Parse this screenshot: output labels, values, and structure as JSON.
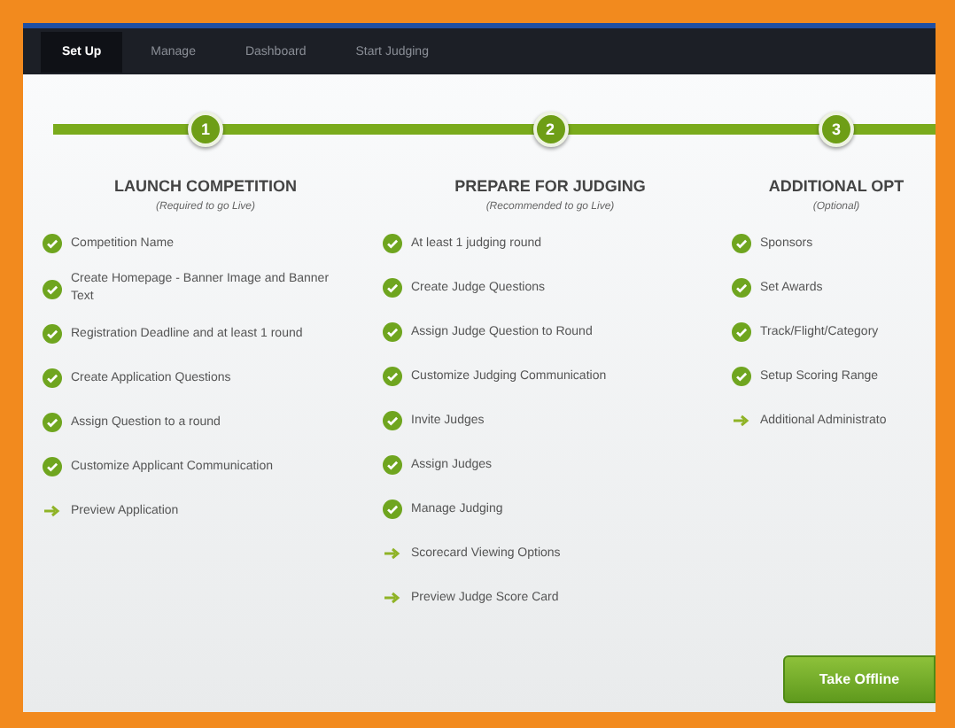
{
  "nav": {
    "tabs": [
      {
        "label": "Set Up",
        "selected": true
      },
      {
        "label": "Manage",
        "selected": false
      },
      {
        "label": "Dashboard",
        "selected": false
      },
      {
        "label": "Start Judging",
        "selected": false
      }
    ]
  },
  "steps": [
    {
      "number": "1",
      "completed": true,
      "title": "LAUNCH COMPETITION",
      "subtitle": "(Required to go Live)",
      "items": [
        {
          "kind": "done",
          "label": "Competition Name"
        },
        {
          "kind": "done",
          "label": "Create Homepage - Banner Image and Banner Text"
        },
        {
          "kind": "done",
          "label": "Registration Deadline and at least 1 round"
        },
        {
          "kind": "done",
          "label": "Create Application Questions"
        },
        {
          "kind": "done",
          "label": "Assign Question to a round"
        },
        {
          "kind": "done",
          "label": "Customize Applicant Communication"
        },
        {
          "kind": "todo",
          "label": "Preview Application"
        }
      ]
    },
    {
      "number": "2",
      "completed": true,
      "title": "PREPARE FOR JUDGING",
      "subtitle": "(Recommended to go Live)",
      "items": [
        {
          "kind": "done",
          "label": "At least 1 judging round"
        },
        {
          "kind": "done",
          "label": "Create Judge Questions"
        },
        {
          "kind": "done",
          "label": "Assign Judge Question to Round"
        },
        {
          "kind": "done",
          "label": "Customize Judging Communication"
        },
        {
          "kind": "done",
          "label": "Invite Judges"
        },
        {
          "kind": "done",
          "label": "Assign Judges"
        },
        {
          "kind": "done",
          "label": "Manage Judging"
        },
        {
          "kind": "todo",
          "label": "Scorecard Viewing Options"
        },
        {
          "kind": "todo",
          "label": "Preview Judge Score Card"
        }
      ]
    },
    {
      "number": "3",
      "completed": true,
      "title": "ADDITIONAL OPT",
      "subtitle": "(Optional)",
      "items": [
        {
          "kind": "done",
          "label": "Sponsors"
        },
        {
          "kind": "done",
          "label": "Set Awards"
        },
        {
          "kind": "done",
          "label": "Track/Flight/Category"
        },
        {
          "kind": "done",
          "label": "Setup Scoring Range"
        },
        {
          "kind": "todo",
          "label": "Additional Administrato"
        }
      ]
    }
  ],
  "action_button": "Take Offline"
}
